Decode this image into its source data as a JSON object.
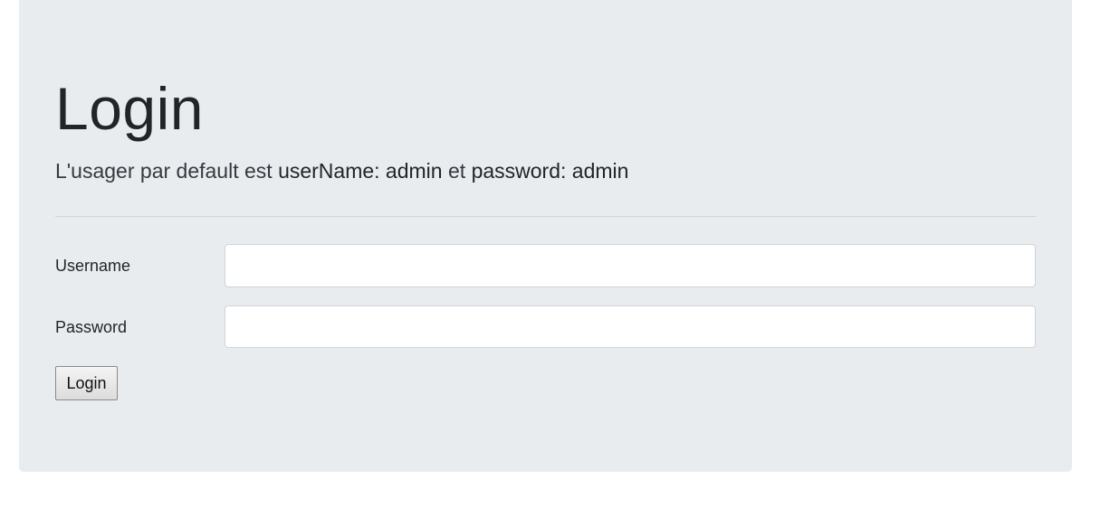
{
  "page": {
    "title": "Login",
    "lead": {
      "prefix": "L'usager par default est ",
      "username_hint": "userName: admin",
      "conjunction": " et ",
      "password_hint": "password: admin"
    }
  },
  "form": {
    "username": {
      "label": "Username",
      "value": ""
    },
    "password": {
      "label": "Password",
      "value": ""
    },
    "submit_label": "Login"
  },
  "colors": {
    "panel_background": "#e9ecef",
    "text": "#212529",
    "input_border": "#ced4da"
  }
}
